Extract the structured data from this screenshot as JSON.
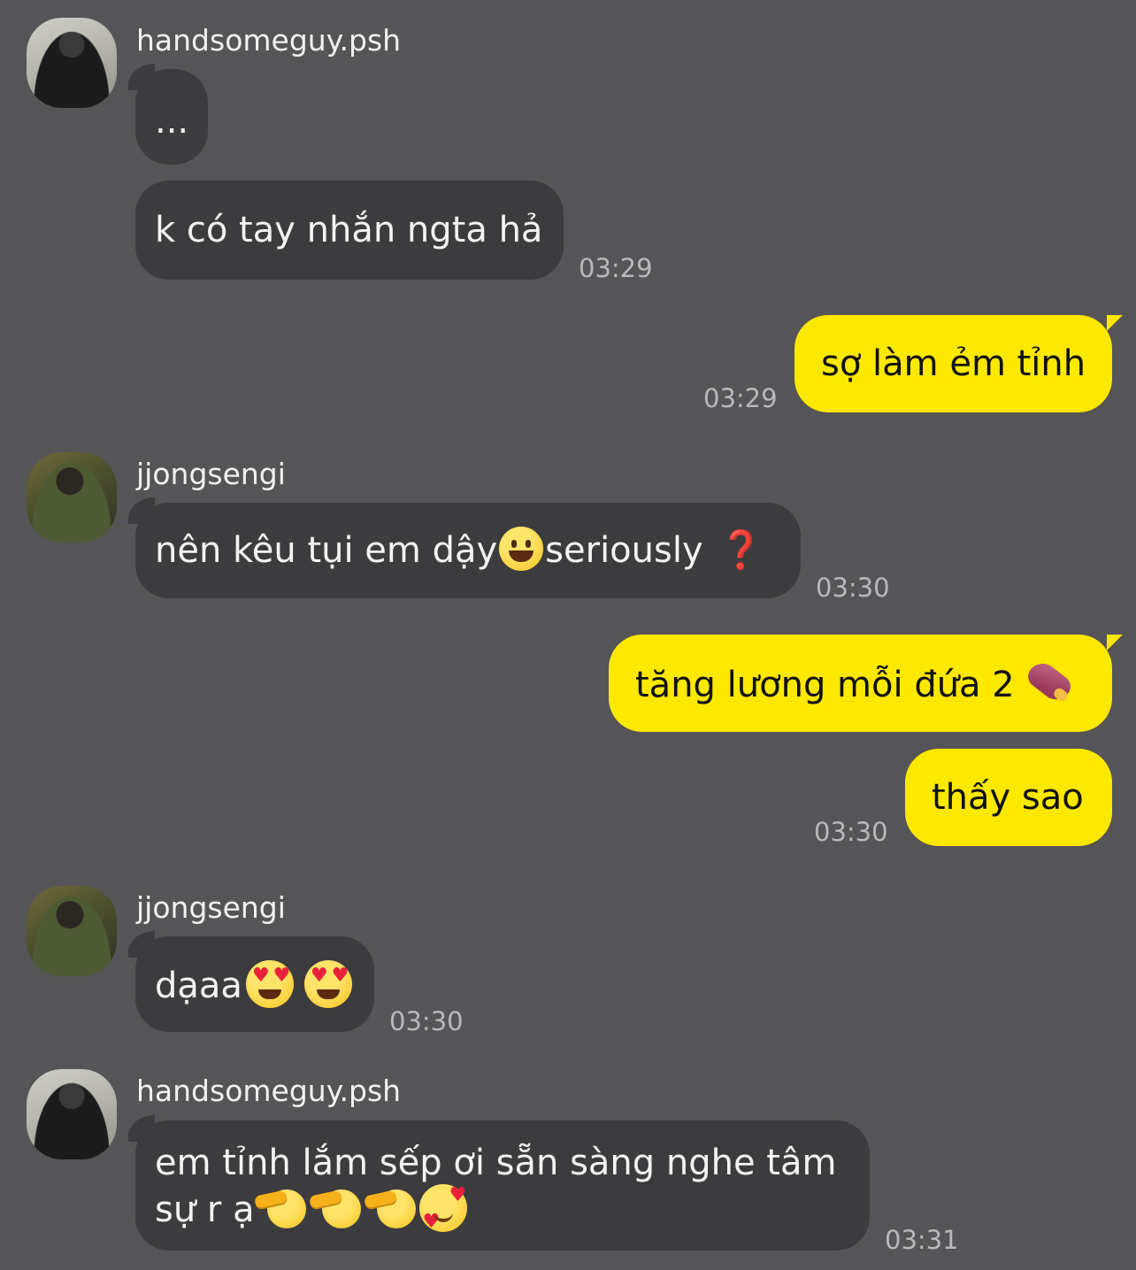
{
  "messages": [
    {
      "sender": "handsomeguy.psh",
      "avatar_icon": "user-avatar",
      "bubbles": [
        "...",
        "k có tay nhắn ngta hả"
      ],
      "time": "03:29"
    },
    {
      "outgoing": true,
      "bubbles": [
        "sợ làm ẻm tỉnh"
      ],
      "time": "03:29"
    },
    {
      "sender": "jjongsengi",
      "avatar_icon": "user-avatar",
      "bubbles": [
        {
          "before": "nên kêu tụi em dậy",
          "after": "seriously",
          "emojis": [
            "grinning-face-emoji",
            "red-question-mark-emoji"
          ],
          "question_mark": "❓"
        }
      ],
      "time": "03:30"
    },
    {
      "outgoing": true,
      "bubbles": [
        {
          "text": "tăng lương mỗi đứa 2",
          "emojis": [
            "roasted-sweet-potato-emoji"
          ]
        },
        "thấy sao"
      ],
      "time": "03:30"
    },
    {
      "sender": "jjongsengi",
      "avatar_icon": "user-avatar",
      "bubbles": [
        {
          "text": "dạaa",
          "emojis": [
            "heart-eyes-emoji",
            "heart-eyes-emoji"
          ]
        }
      ],
      "time": "03:30"
    },
    {
      "sender": "handsomeguy.psh",
      "avatar_icon": "user-avatar",
      "bubbles": [
        {
          "line1": "em tỉnh lắm sếp ơi sẵn sàng nghe tâm",
          "line2": "sự r ạ",
          "emojis": [
            "saluting-face-emoji",
            "saluting-face-emoji",
            "saluting-face-emoji",
            "smiling-face-with-hearts-emoji"
          ]
        }
      ],
      "time": "03:31"
    }
  ],
  "colors": {
    "background": "#555456",
    "incoming_bubble": "#3c3b3e",
    "outgoing_bubble": "#fde800",
    "timestamp": "#b9b8bb"
  }
}
